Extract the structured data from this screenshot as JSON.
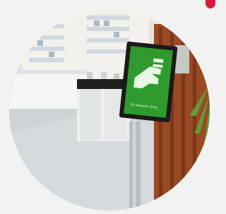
{
  "image": {
    "scene": "pharmacy-kiosk",
    "kiosk_screen_text": "Os Warenix Srvg",
    "colors": {
      "background": "#f2f2f2",
      "accent_red": "#d81b3c",
      "kiosk_screen_green": "#2f9a2d",
      "floor_grey": "#cfd3d6",
      "wood_panel": "#9a4a22",
      "counter_white": "#eef0f0"
    }
  }
}
